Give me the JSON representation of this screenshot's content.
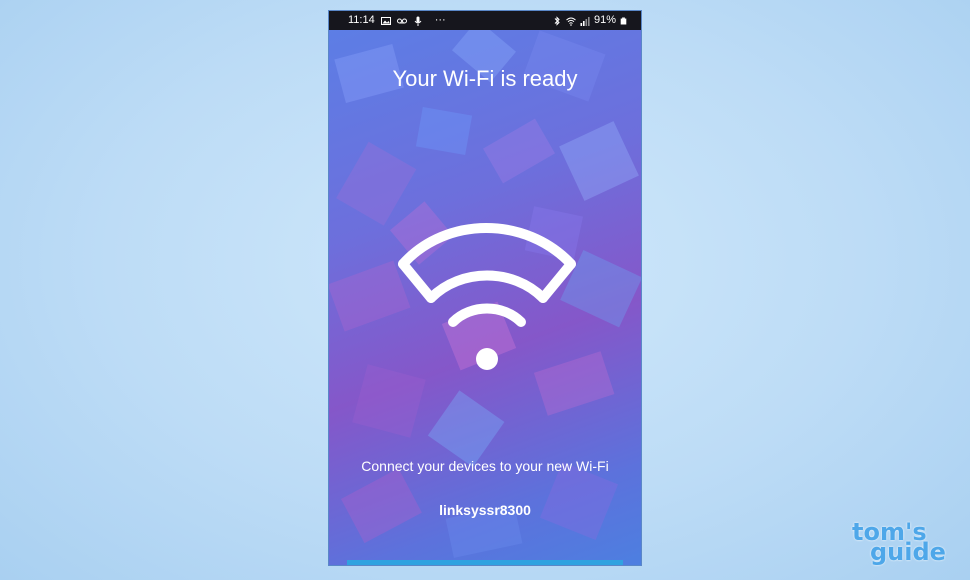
{
  "status_bar": {
    "time": "11:14",
    "dots": "···",
    "battery": "91%",
    "icons_left": [
      "gallery-icon",
      "voicemail-icon",
      "mic-icon"
    ],
    "icons_right": [
      "bluetooth-icon",
      "wifi-signal-icon",
      "cell-signal-icon",
      "battery-icon"
    ]
  },
  "screen": {
    "title": "Your Wi-Fi is ready",
    "hero_icon": "wifi-icon",
    "caption": "Connect your devices to your new Wi-Fi",
    "network_name": "linksyssr8300"
  },
  "watermark": {
    "line1": "tom's",
    "line2": "guide"
  },
  "colors": {
    "page_background": "#bddcf6",
    "status_bar": "#16161d",
    "accent_bar": "#2fa2e0",
    "watermark": "#4ea7e9",
    "text": "#ffffff"
  }
}
